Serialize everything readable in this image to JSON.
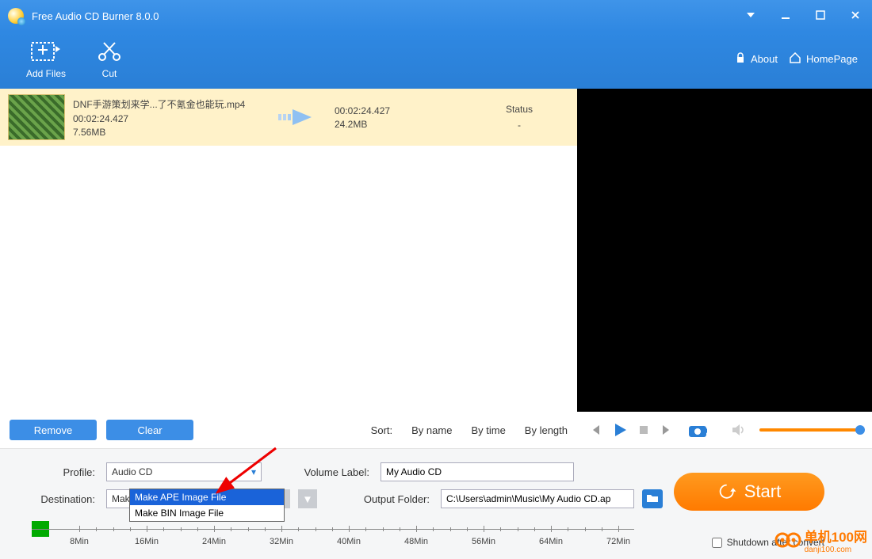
{
  "app": {
    "title": "Free Audio CD Burner 8.0.0"
  },
  "toolbar": {
    "add_files": "Add Files",
    "cut": "Cut",
    "about": "About",
    "homepage": "HomePage"
  },
  "file": {
    "name": "DNF手游策划来学...了不氪金也能玩.mp4",
    "src_duration": "00:02:24.427",
    "src_size": "7.56MB",
    "dst_duration": "00:02:24.427",
    "dst_size": "24.2MB",
    "status_label": "Status",
    "status_value": "-"
  },
  "list_actions": {
    "remove": "Remove",
    "clear": "Clear",
    "sort_label": "Sort:",
    "by_name": "By name",
    "by_time": "By time",
    "by_length": "By length"
  },
  "settings": {
    "profile_label": "Profile:",
    "profile_value": "Audio CD",
    "destination_label": "Destination:",
    "destination_value": "Make APE Image File",
    "destination_options": [
      "Make APE Image File",
      "Make BIN Image File"
    ],
    "volume_label": "Volume Label:",
    "volume_value": "My Audio CD",
    "output_label": "Output Folder:",
    "output_value": "C:\\Users\\admin\\Music\\My Audio CD.ap",
    "start": "Start",
    "shutdown": "Shutdown after convert"
  },
  "timeline": {
    "ticks": [
      "8Min",
      "16Min",
      "24Min",
      "32Min",
      "40Min",
      "48Min",
      "56Min",
      "64Min",
      "72Min"
    ]
  },
  "watermark": {
    "line1": "单机100网",
    "line2": "danji100.com"
  }
}
